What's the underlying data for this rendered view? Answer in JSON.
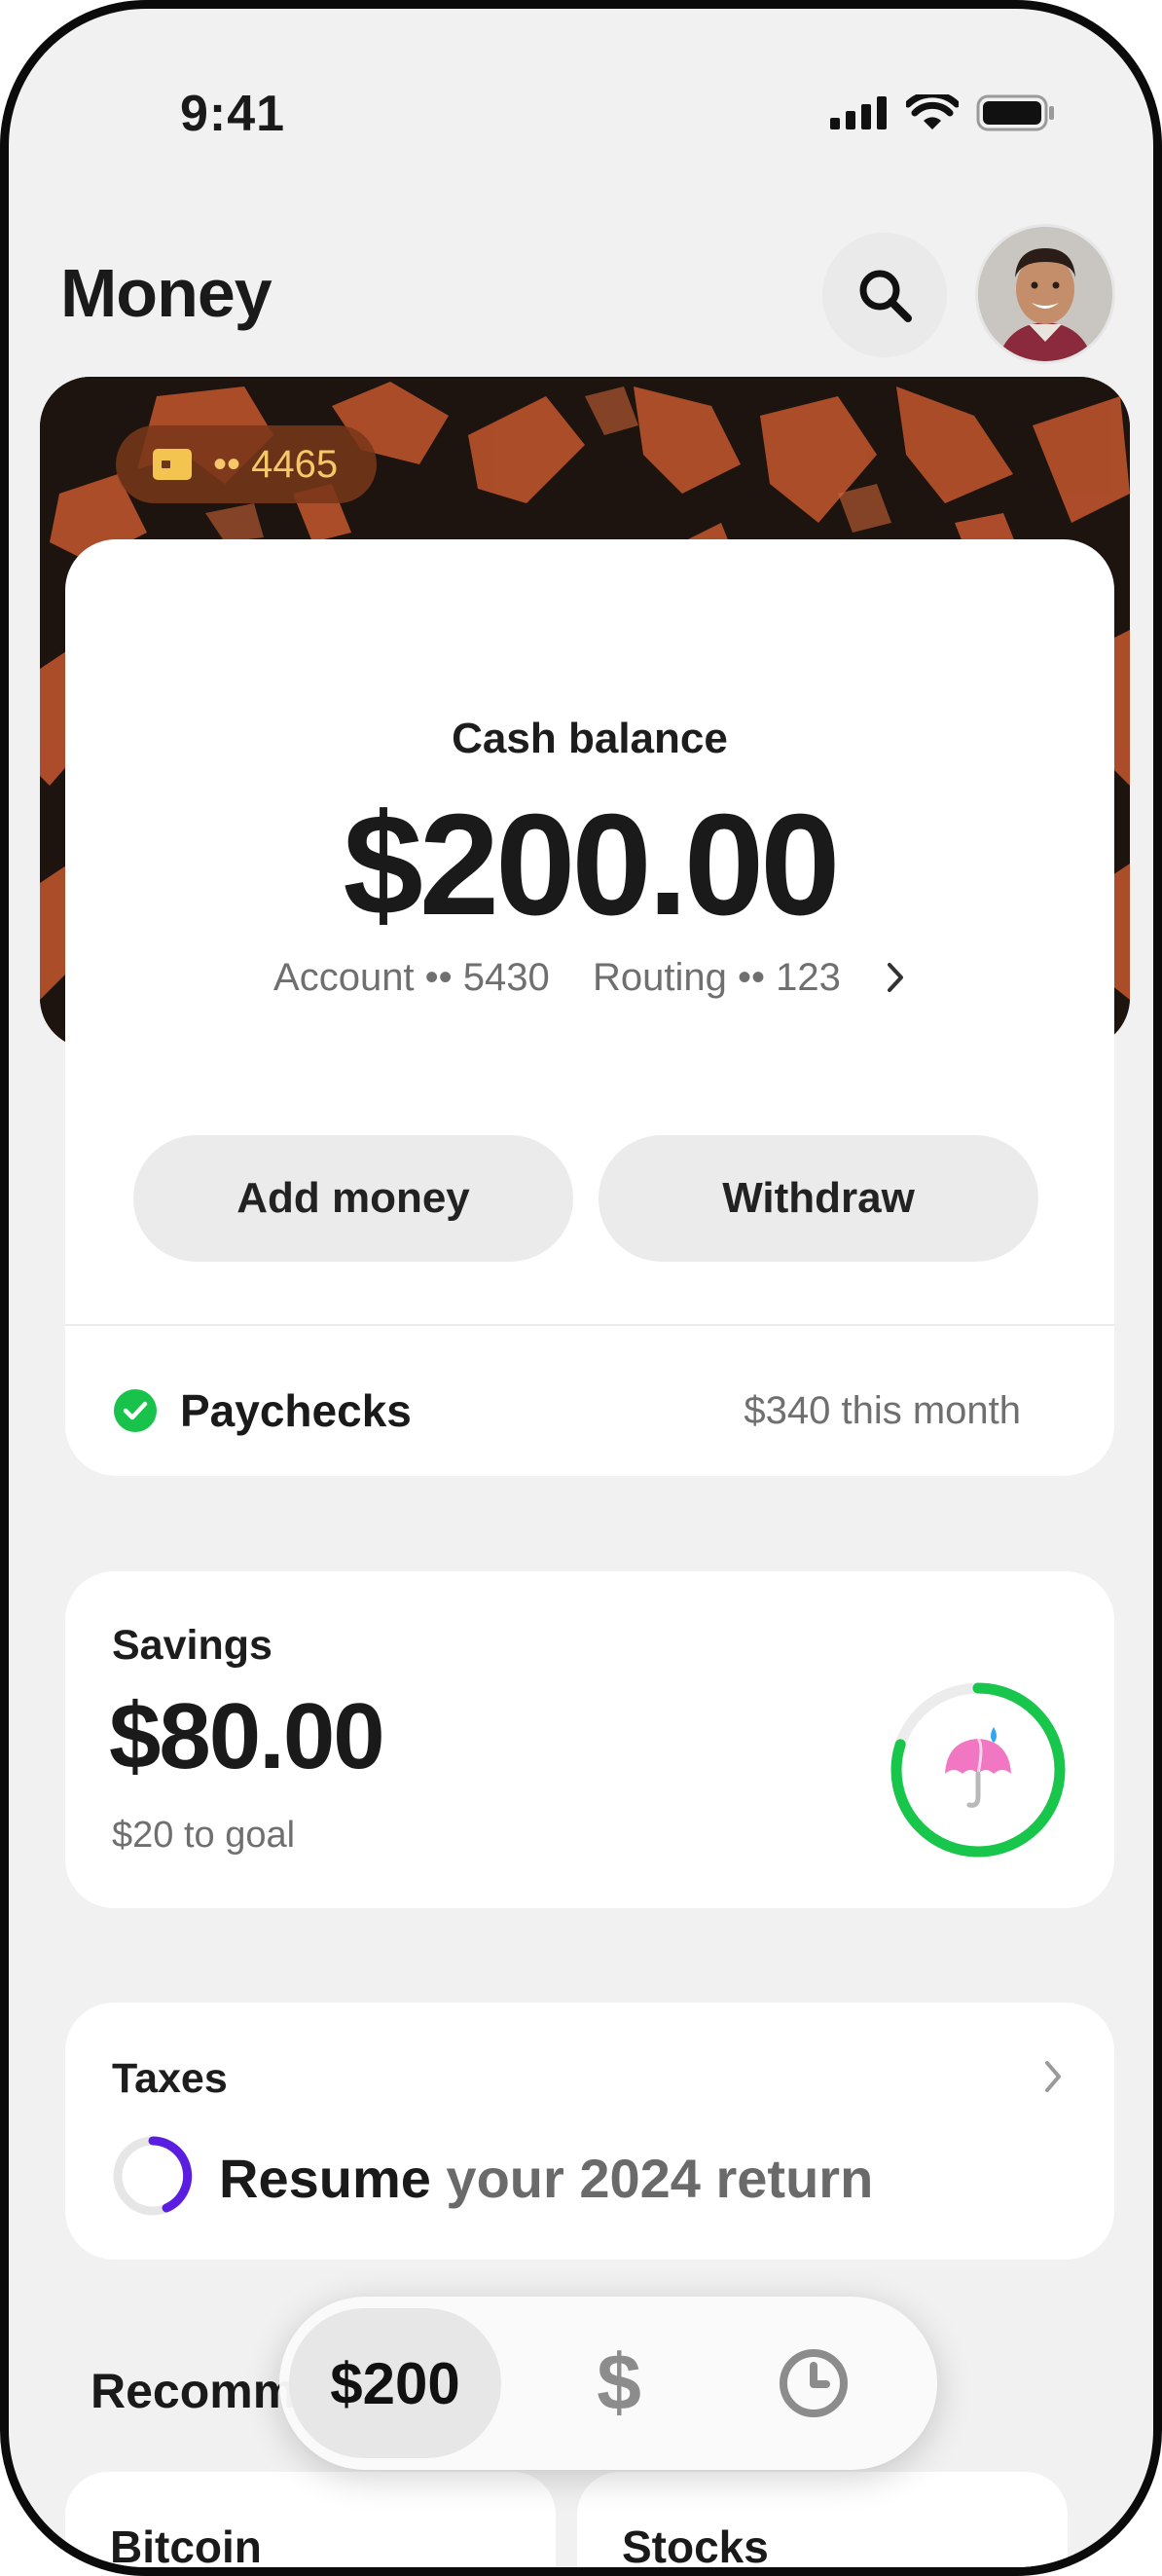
{
  "status_bar": {
    "time": "9:41"
  },
  "header": {
    "title": "Money"
  },
  "cash_card": {
    "card_last4": "•• 4465",
    "label": "Cash balance",
    "amount": "$200.00",
    "account": "Account •• 5430",
    "routing": "Routing •• 123",
    "add_money_label": "Add money",
    "withdraw_label": "Withdraw",
    "paychecks_label": "Paychecks",
    "paychecks_amount": "$340 this month"
  },
  "savings": {
    "label": "Savings",
    "amount": "$80.00",
    "goal_text": "$20 to goal",
    "progress": 0.8,
    "ring_color": "#17c64a"
  },
  "taxes": {
    "label": "Taxes",
    "cta_strong": "Resume",
    "cta_rest": " your 2024 return",
    "ring_color": "#5b1ee0"
  },
  "recommended": {
    "title": "Recomm",
    "tiles": [
      "Bitcoin",
      "Stocks"
    ]
  },
  "tabbar": {
    "balance_label": "$200",
    "dollar_glyph": "$"
  },
  "colors": {
    "accent_green": "#19c34b",
    "background": "#f1f1f1"
  }
}
